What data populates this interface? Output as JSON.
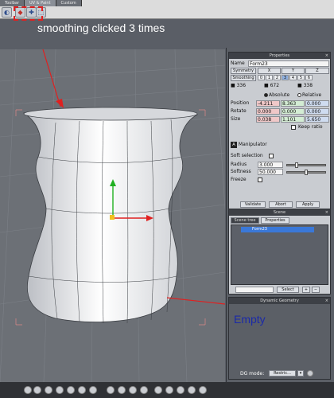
{
  "toolbar": {
    "tabs": [
      "Toolbar",
      "UV & Paint",
      "Custom"
    ],
    "tools": [
      "view-icon",
      "red-shape-icon",
      "smooth-plus-icon",
      "crop-icon"
    ],
    "annotation": "smoothing clicked 3 times"
  },
  "viewport": {
    "annotation": "Empty",
    "arrow_color": "#e02020",
    "object_color": "#eeeeee"
  },
  "properties": {
    "title": "Properties",
    "name_label": "Name",
    "name_value": "Form23",
    "symmetry_label": "Symmetry",
    "axes": [
      "X",
      "Y",
      "Z"
    ],
    "smoothing_label": "Smoothing",
    "smoothing_levels": [
      "0",
      "1",
      "2",
      "3",
      "4",
      "5",
      "6"
    ],
    "counts": [
      "336",
      "672",
      "338"
    ],
    "absolute_label": "Absolute",
    "relative_label": "Relative",
    "position_label": "Position",
    "position": [
      "-4.211",
      "8.363",
      "0.000"
    ],
    "rotate_label": "Rotate",
    "rotate": [
      "0.000",
      "0.000",
      "0.000"
    ],
    "size_label": "Size",
    "size": [
      "0.038",
      "1.101",
      "5.650"
    ],
    "keep_ratio_label": "Keep ratio",
    "manipulator_label": "Manipulator",
    "soft_selection_label": "Soft selection",
    "radius_label": "Radius",
    "radius_value": "3.000",
    "softness_label": "Softness",
    "softness_value": "50.000",
    "freeze_label": "Freeze",
    "validate_label": "Validate",
    "abort_label": "Abort",
    "apply_label": "Apply"
  },
  "scene": {
    "title": "Scene",
    "tab_tree": "Scene tree",
    "tab_props": "Properties",
    "item": "Form23",
    "select_label": "Select"
  },
  "dynamic": {
    "title": "Dynamic Geometry",
    "dg_mode_label": "DG mode:",
    "dg_mode_value": "Restric..."
  }
}
